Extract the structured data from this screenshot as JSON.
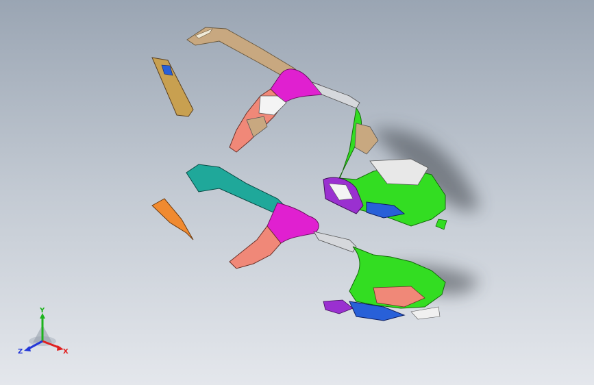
{
  "triad": {
    "x_label": "X",
    "y_label": "Y",
    "z_label": "Z",
    "x_color": "#e02020",
    "y_color": "#1db31d",
    "z_color": "#2438d8"
  },
  "colors": {
    "background_top": "#9aa5b3",
    "background_bottom": "#e4e7ec",
    "green": "#33dd22",
    "magenta": "#e020d0",
    "salmon": "#f08878",
    "teal": "#1fa89a",
    "orange": "#f08a30",
    "tan": "#c8a880",
    "blue": "#2860d8",
    "purple": "#9a30d0"
  }
}
